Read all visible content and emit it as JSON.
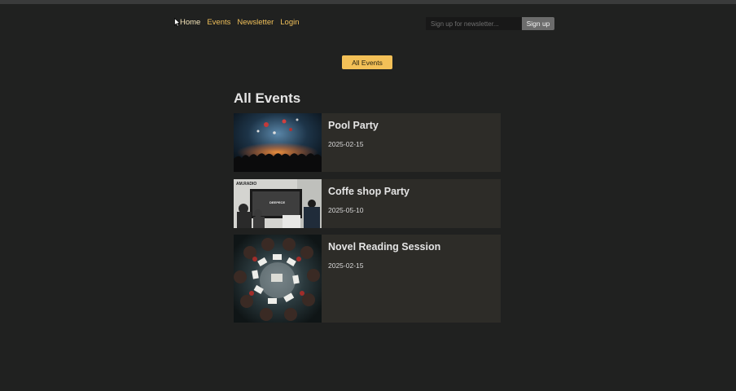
{
  "nav": {
    "items": [
      {
        "label": "Home"
      },
      {
        "label": "Events"
      },
      {
        "label": "Newsletter"
      },
      {
        "label": "Login"
      }
    ],
    "color": "#f0c05a"
  },
  "newsletter": {
    "placeholder": "Sign up for newsletter...",
    "button_label": "Sign up"
  },
  "filter": {
    "label": "All Events",
    "color": "#f3c057"
  },
  "main": {
    "heading": "All Events",
    "events": [
      {
        "title": "Pool Party",
        "date": "2025-02-15"
      },
      {
        "title": "Coffe shop Party",
        "date": "2025-05-10"
      },
      {
        "title": "Novel Reading Session",
        "date": "2025-02-15"
      }
    ]
  },
  "images": {
    "event_2_sign": "AM.RADIO",
    "event_2_screen": "DEEPECE"
  }
}
